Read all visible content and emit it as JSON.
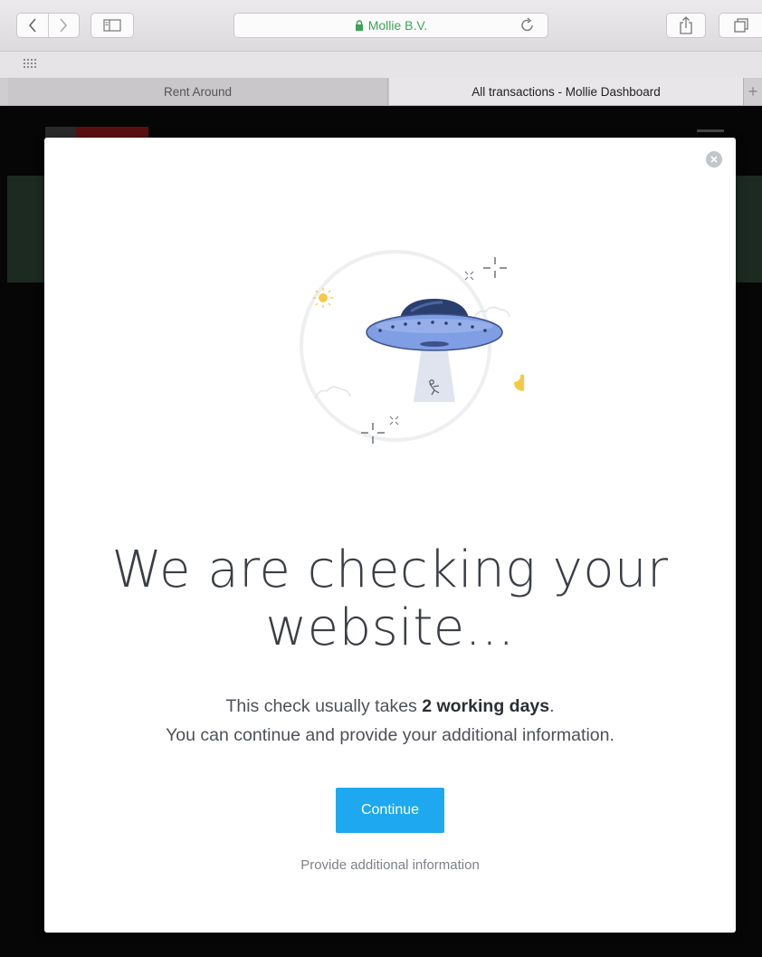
{
  "browser": {
    "url_title": "Mollie B.V.",
    "tabs": [
      {
        "label": "Rent Around",
        "active": false
      },
      {
        "label": "All transactions - Mollie Dashboard",
        "active": true
      }
    ],
    "new_tab_label": "+",
    "icons": {
      "back": "chevron-left-icon",
      "forward": "chevron-right-icon",
      "sidebar": "sidebar-icon",
      "lock": "lock-icon",
      "reload": "reload-icon",
      "share": "share-icon",
      "tabs": "tabs-overview-icon",
      "favorites": "grid-icon"
    },
    "url_color": "#3aa557"
  },
  "modal": {
    "headline_line1": "We are checking your",
    "headline_line2": "website...",
    "body_prefix": "This check usually takes ",
    "body_bold": "2 working days",
    "body_suffix": ".",
    "body_line2": "You can continue and provide your additional information.",
    "continue_label": "Continue",
    "alt_link_label": "Provide additional information",
    "accent_color": "#1ea8ef",
    "close_icon": "close-icon",
    "illustration": "ufo-beam-illustration"
  }
}
